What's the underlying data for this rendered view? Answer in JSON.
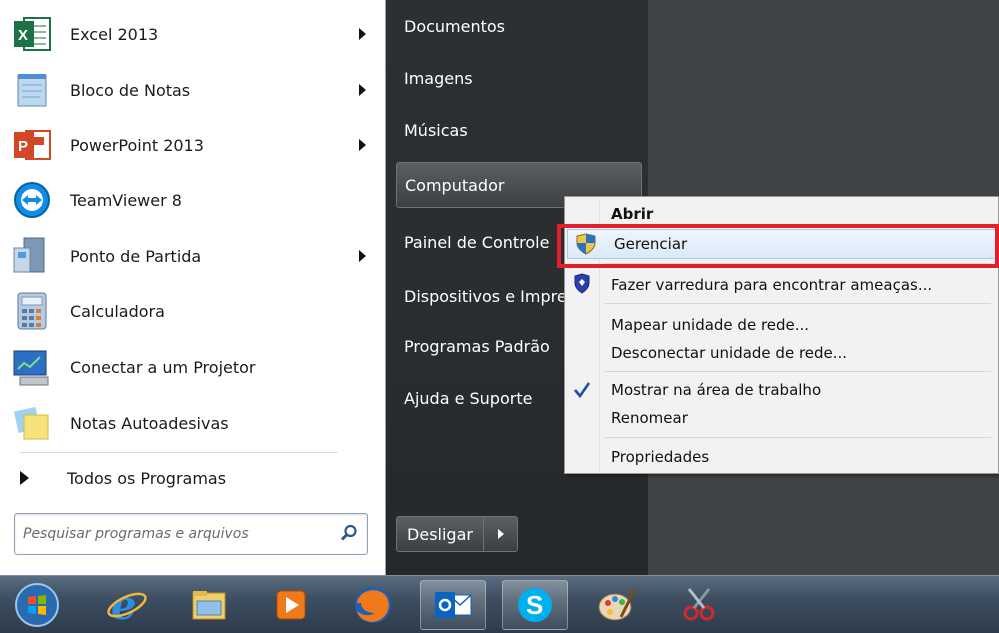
{
  "programs": [
    {
      "label": "Excel 2013",
      "has_arrow": true,
      "icon": "excel-icon"
    },
    {
      "label": "Bloco de Notas",
      "has_arrow": true,
      "icon": "notepad-icon"
    },
    {
      "label": "PowerPoint 2013",
      "has_arrow": true,
      "icon": "powerpoint-icon"
    },
    {
      "label": "TeamViewer 8",
      "has_arrow": false,
      "icon": "teamviewer-icon"
    },
    {
      "label": "Ponto de Partida",
      "has_arrow": true,
      "icon": "getting-started-icon"
    },
    {
      "label": "Calculadora",
      "has_arrow": false,
      "icon": "calculator-icon"
    },
    {
      "label": "Conectar a um Projetor",
      "has_arrow": false,
      "icon": "projector-icon"
    },
    {
      "label": "Notas Autoadesivas",
      "has_arrow": false,
      "icon": "sticky-notes-icon"
    }
  ],
  "all_programs_label": "Todos os Programas",
  "search": {
    "placeholder": "Pesquisar programas e arquivos"
  },
  "right_items": [
    {
      "label": "Documentos"
    },
    {
      "label": "Imagens"
    },
    {
      "label": "Músicas"
    },
    {
      "label": "Computador",
      "highlighted": true
    },
    {
      "label": "Painel de Controle"
    },
    {
      "label": "Dispositivos e Impre"
    },
    {
      "label": "Programas Padrão"
    },
    {
      "label": "Ajuda e Suporte"
    }
  ],
  "shutdown": {
    "label": "Desligar"
  },
  "context_menu": {
    "items": [
      {
        "label": "Abrir",
        "bold": true,
        "icon": ""
      },
      {
        "label": "Gerenciar",
        "icon": "uac-shield-icon",
        "hovered": true
      },
      {
        "label": "Fazer varredura para encontrar ameaças...",
        "icon": "security-shield-icon"
      },
      {
        "label": "Mapear unidade de rede..."
      },
      {
        "label": "Desconectar unidade de rede..."
      },
      {
        "label": "Mostrar na área de trabalho",
        "icon": "checkmark-icon",
        "checked": true
      },
      {
        "label": "Renomear"
      },
      {
        "label": "Propriedades"
      }
    ],
    "highlight_color": "#e2202a"
  },
  "taskbar": {
    "items": [
      "start-orb-icon",
      "internet-explorer-icon",
      "file-explorer-icon",
      "media-player-icon",
      "firefox-icon",
      "outlook-icon",
      "skype-icon",
      "paint-icon",
      "snipping-tool-icon"
    ]
  },
  "colors": {
    "accent": "#e2202a",
    "menu_dark": "#2c3033",
    "taskbar": "#3c4e60"
  }
}
